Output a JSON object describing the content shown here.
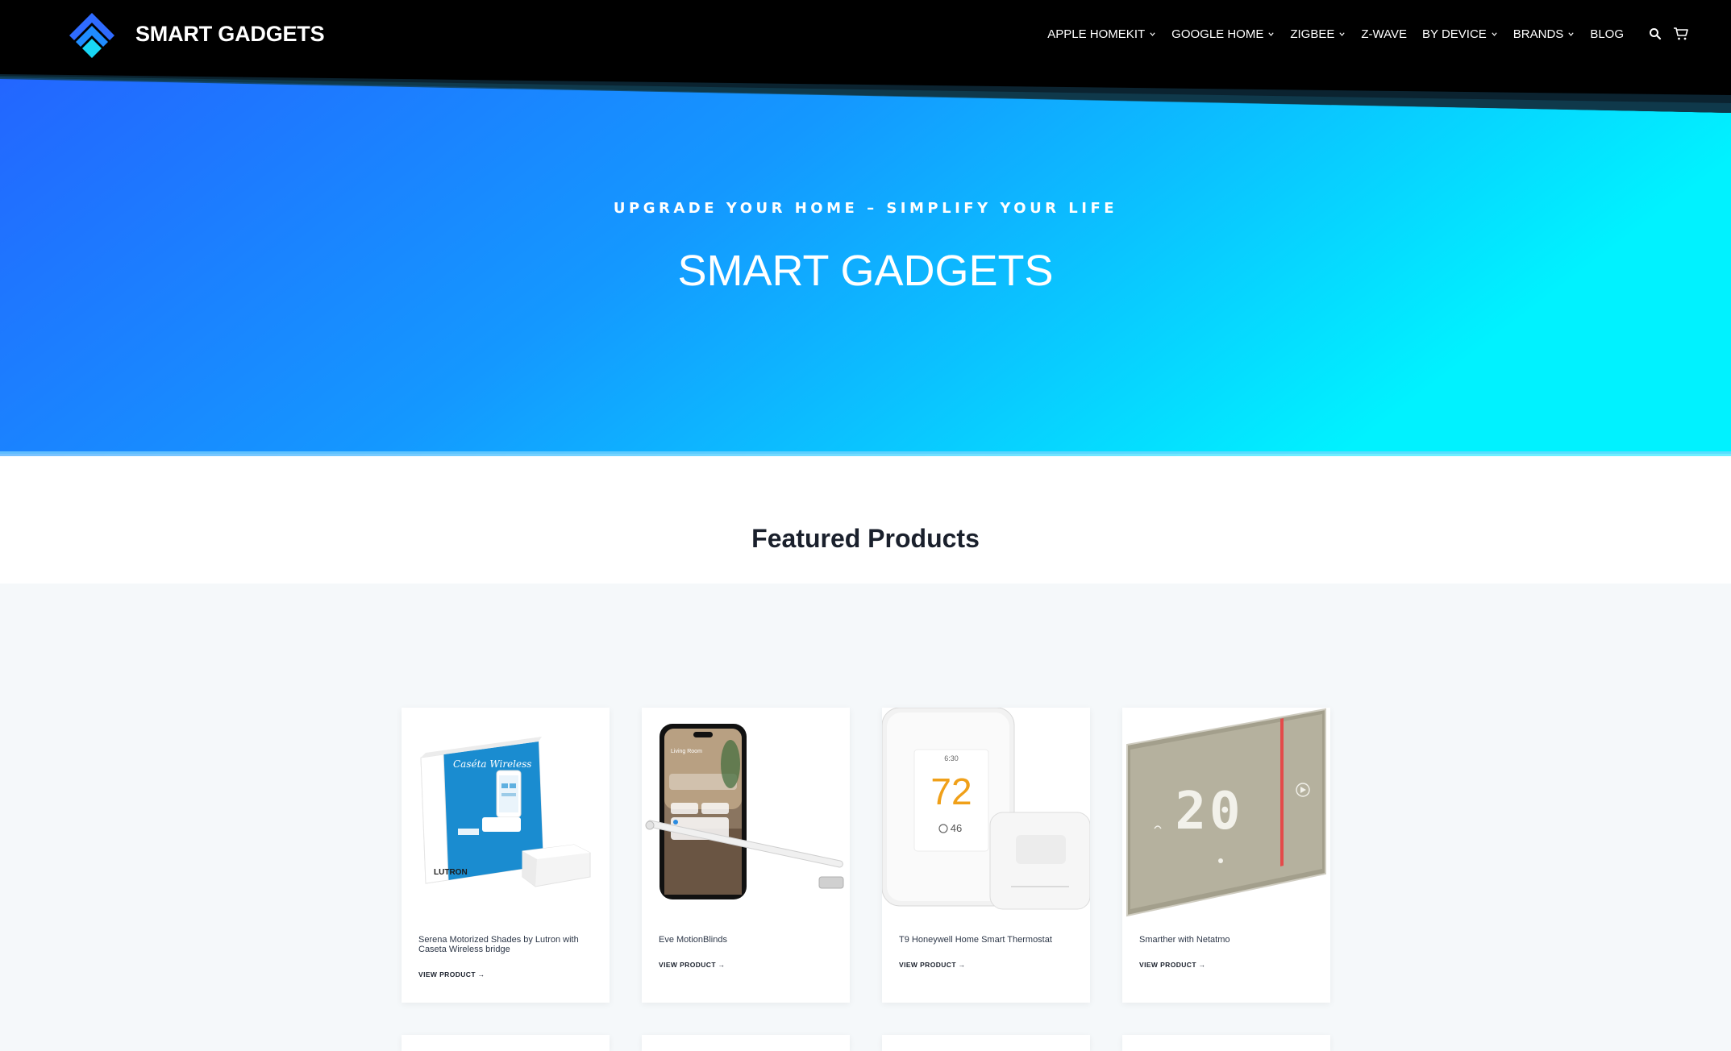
{
  "site": {
    "brand": "SMART GADGETS"
  },
  "nav": {
    "items": [
      {
        "label": "APPLE HOMEKIT",
        "dropdown": true
      },
      {
        "label": "GOOGLE HOME",
        "dropdown": true
      },
      {
        "label": "ZIGBEE",
        "dropdown": true
      },
      {
        "label": "Z-WAVE",
        "dropdown": false
      },
      {
        "label": "BY DEVICE",
        "dropdown": true
      },
      {
        "label": "BRANDS",
        "dropdown": true
      },
      {
        "label": "BLOG",
        "dropdown": false
      }
    ],
    "icons": [
      "search-icon",
      "cart-icon"
    ]
  },
  "hero": {
    "subtitle": "UPGRADE YOUR HOME – SIMPLIFY YOUR LIFE",
    "title": "SMART GADGETS",
    "gradient_start": "#2563ff",
    "gradient_end": "#00f0ff"
  },
  "featured": {
    "title": "Featured Products",
    "products": [
      {
        "name": "Serena Motorized Shades by Lutron with Caseta Wireless bridge",
        "link": "VIEW PRODUCT →"
      },
      {
        "name": "Eve MotionBlinds",
        "link": "VIEW PRODUCT →"
      },
      {
        "name": "T9 Honeywell Home Smart Thermostat",
        "link": "VIEW PRODUCT →"
      },
      {
        "name": "Smarther with Netatmo",
        "link": "VIEW PRODUCT →"
      }
    ],
    "thermostat_display": {
      "time": "6:30",
      "temp": "72",
      "indoor": "46"
    },
    "netatmo_display": "20",
    "lutron_box_label": "Caséta Wireless",
    "lutron_brand": "LUTRON",
    "phone_screen_title": "Living Room"
  }
}
